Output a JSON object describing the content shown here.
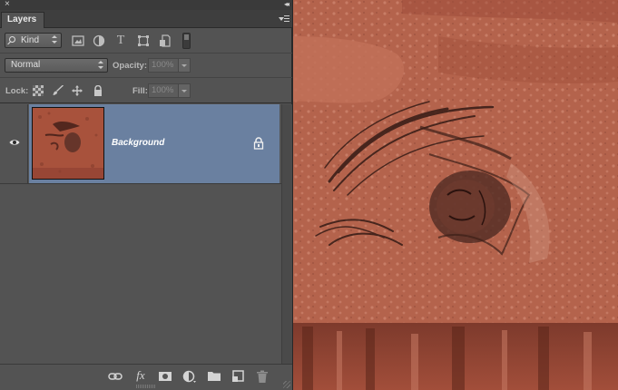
{
  "panel": {
    "close_glyph": "×",
    "collapse_glyph": "◂◂",
    "tab_label": "Layers",
    "menu_icon": "panel-menu-icon"
  },
  "filter": {
    "kind_label": "Kind",
    "icons": [
      "pixel-layer-filter-icon",
      "adjustment-layer-filter-icon",
      "type-layer-filter-icon",
      "shape-layer-filter-icon",
      "smart-object-filter-icon"
    ],
    "type_glyph": "T"
  },
  "blend": {
    "mode": "Normal",
    "opacity_label": "Opacity:",
    "opacity_value": "100%"
  },
  "lock": {
    "label": "Lock:",
    "fill_label": "Fill:",
    "fill_value": "100%"
  },
  "layers": [
    {
      "name": "Background",
      "visible": true,
      "locked": true,
      "selected": true
    }
  ],
  "bottom_bar": {
    "fx_glyph": "fx",
    "icons": [
      "link-layers-icon",
      "layer-style-icon",
      "add-mask-icon",
      "new-adjustment-icon",
      "new-group-icon",
      "new-layer-icon",
      "delete-layer-icon"
    ]
  },
  "colors": {
    "panel_bg": "#535353",
    "selected_layer": "#6a80a0",
    "canvas_tint": "#b4634c"
  }
}
